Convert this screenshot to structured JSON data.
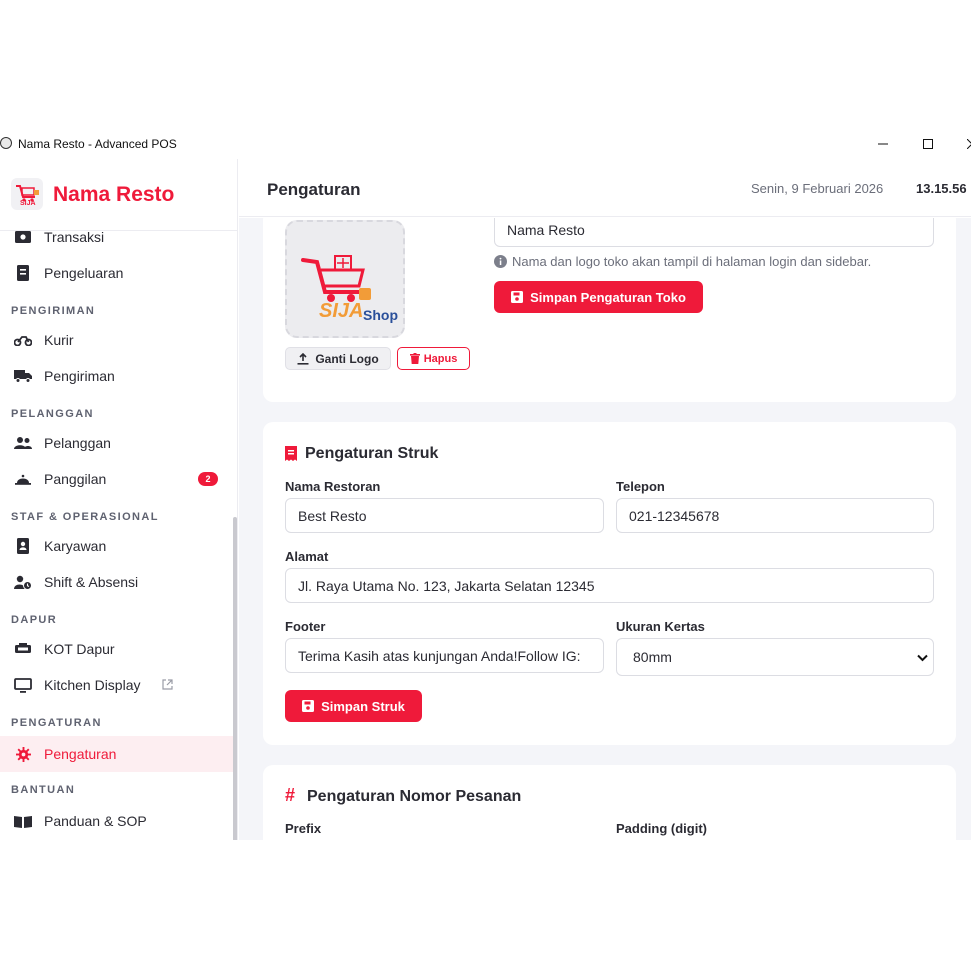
{
  "window": {
    "title": "Nama Resto - Advanced POS"
  },
  "brand": {
    "name": "Nama Resto",
    "accent": "#ef1a3a"
  },
  "sidebar": {
    "items": [
      {
        "label": "Transaksi",
        "icon": "money-icon"
      },
      {
        "label": "Pengeluaran",
        "icon": "receipt-icon"
      },
      {
        "label": "Kurir",
        "icon": "motorcycle-icon"
      },
      {
        "label": "Pengiriman",
        "icon": "truck-icon"
      },
      {
        "label": "Pelanggan",
        "icon": "users-icon"
      },
      {
        "label": "Panggilan",
        "icon": "bell-icon",
        "badge": "2"
      },
      {
        "label": "Karyawan",
        "icon": "id-badge-icon"
      },
      {
        "label": "Shift & Absensi",
        "icon": "user-clock-icon"
      },
      {
        "label": "KOT Dapur",
        "icon": "printer-icon"
      },
      {
        "label": "Kitchen Display",
        "icon": "monitor-icon"
      },
      {
        "label": "Pengaturan",
        "icon": "gear-icon"
      },
      {
        "label": "Panduan & SOP",
        "icon": "book-icon"
      }
    ],
    "sections": [
      "PENGIRIMAN",
      "PELANGGAN",
      "STAF & OPERASIONAL",
      "DAPUR",
      "PENGATURAN",
      "BANTUAN"
    ]
  },
  "header": {
    "title": "Pengaturan",
    "date": "Senin, 9 Februari 2026",
    "time": "13.15.56"
  },
  "store_card": {
    "logo_text_1": "SIJA",
    "logo_text_2": "Shop",
    "change_logo": "Ganti Logo",
    "delete": "Hapus",
    "store_name_value": "Nama Resto",
    "hint": "Nama dan logo toko akan tampil di halaman login dan sidebar.",
    "save": "Simpan Pengaturan Toko"
  },
  "receipt_card": {
    "title": "Pengaturan Struk",
    "fields": {
      "restaurant_label": "Nama Restoran",
      "restaurant_value": "Best Resto",
      "phone_label": "Telepon",
      "phone_value": "021-12345678",
      "address_label": "Alamat",
      "address_value": "Jl. Raya Utama No. 123, Jakarta Selatan 12345",
      "footer_label": "Footer",
      "footer_value": "Terima Kasih atas kunjungan Anda!Follow IG:",
      "paper_label": "Ukuran Kertas",
      "paper_value": "80mm"
    },
    "save": "Simpan Struk"
  },
  "order_card": {
    "title": "Pengaturan Nomor Pesanan",
    "prefix_label": "Prefix",
    "padding_label": "Padding (digit)"
  }
}
